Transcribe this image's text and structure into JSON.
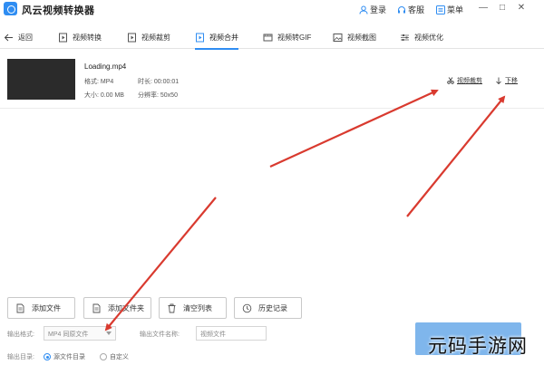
{
  "titlebar": {
    "app_name": "风云视频转换器",
    "login": "登录",
    "support": "客服",
    "menu": "菜单",
    "minimize": "—",
    "maximize": "□",
    "close": "✕"
  },
  "toolbar": {
    "back": "返回",
    "tools": [
      {
        "label": "视频转换",
        "icon": "convert-icon"
      },
      {
        "label": "视频裁剪",
        "icon": "crop-icon"
      },
      {
        "label": "视频合并",
        "icon": "merge-icon",
        "active": true
      },
      {
        "label": "视频转GIF",
        "icon": "gif-icon"
      },
      {
        "label": "视频截图",
        "icon": "screenshot-icon"
      },
      {
        "label": "视频优化",
        "icon": "optimize-icon"
      }
    ]
  },
  "file": {
    "name": "Loading.mp4",
    "format_label": "格式: MP4",
    "duration_label": "时长: 00:00:01",
    "size_label": "大小: 0.00 MB",
    "resolution_label": "分辨率: 50x50",
    "crop_action": "视频裁剪",
    "move_down_action": "下移"
  },
  "buttons": {
    "add_file": "添加文件",
    "add_folder": "添加文件夹",
    "clear_list": "清空列表",
    "history": "历史记录"
  },
  "output": {
    "format_label": "输出格式:",
    "format_value": "MP4 同原文件",
    "filename_label": "输出文件名称:",
    "filename_value": "视频文件",
    "dir_label": "输出目录:",
    "dir_option_source": "源文件目录",
    "dir_option_custom": "自定义"
  },
  "colors": {
    "accent": "#2f8df2",
    "convert_button": "#7fb6ec",
    "annotation_arrow": "#d93a2f"
  },
  "watermark": "元码手游网"
}
